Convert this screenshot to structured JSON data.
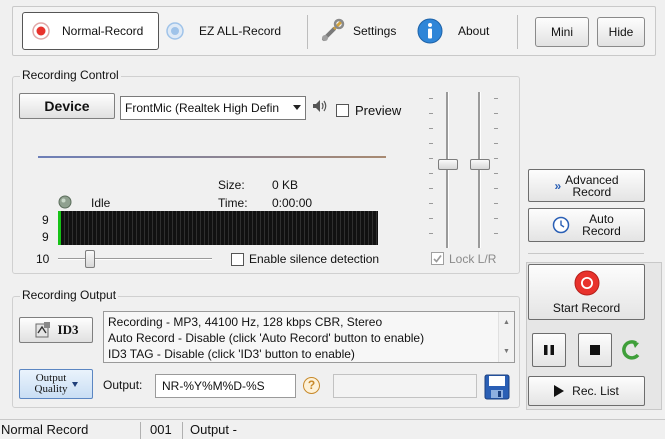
{
  "toolbar": {
    "normal_record": "Normal-Record",
    "ez_all_record": "EZ ALL-Record",
    "settings": "Settings",
    "about": "About",
    "mini": "Mini",
    "hide": "Hide"
  },
  "recording_control": {
    "title": "Recording Control",
    "device_button": "Device",
    "device_value": "FrontMic (Realtek High Defin",
    "preview_label": "Preview",
    "size_label": "Size:",
    "size_value": "0 KB",
    "time_label": "Time:",
    "time_value": "0:00:00",
    "status": "Idle",
    "meter_label_top": "9",
    "meter_label_bottom": "9",
    "sensitivity_value": "10",
    "silence_detection_label": "Enable silence detection",
    "lock_lr_label": "Lock L/R"
  },
  "recording_output": {
    "title": "Recording Output",
    "id3_button": "ID3",
    "info_lines": [
      "Recording - MP3, 44100 Hz, 128 kbps CBR, Stereo",
      "Auto Record - Disable (click 'Auto Record' button to enable)",
      "ID3 TAG - Disable (click 'ID3' button to enable)"
    ],
    "output_quality_line1": "Output",
    "output_quality_line2": "Quality",
    "output_label": "Output:",
    "output_value": "NR-%Y%M%D-%S",
    "help_glyph": "?"
  },
  "right_panel": {
    "advanced_record_line1": "Advanced",
    "advanced_record_line2": "Record",
    "auto_record_line1": "Auto",
    "auto_record_line2": "Record",
    "start_record": "Start Record",
    "rec_list": "Rec. List"
  },
  "statusbar": {
    "mode": "Normal Record",
    "count": "001",
    "output": "Output -"
  },
  "colors": {
    "record_red": "#e8322c",
    "ez_blue": "#9fc3e9",
    "about_blue": "#2f86d8",
    "meter_green": "#17c317",
    "save_blue": "#2a5fb5"
  }
}
